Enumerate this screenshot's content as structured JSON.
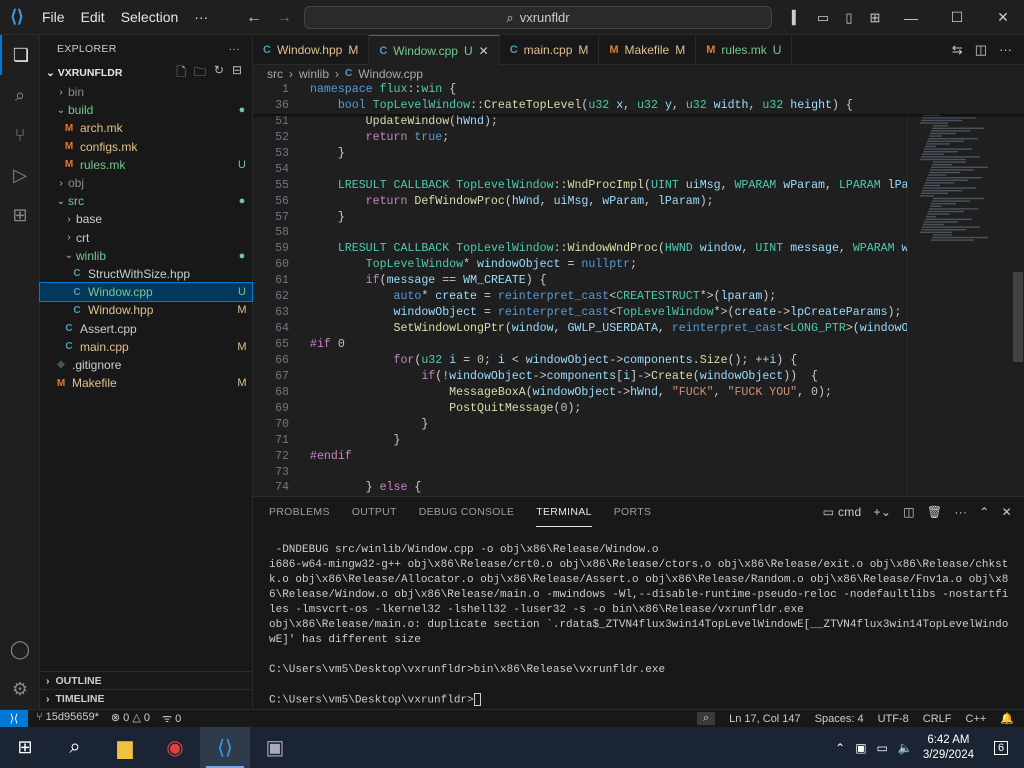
{
  "menu": {
    "file": "File",
    "edit": "Edit",
    "selection": "Selection",
    "more": "···"
  },
  "search": {
    "text": "vxrunfldr"
  },
  "explorer": {
    "title": "EXPLORER",
    "root": "VXRUNFLDR",
    "items": [
      {
        "name": "bin",
        "chev": "›",
        "indent": 0,
        "type": "folder",
        "badge": "",
        "color": "dim"
      },
      {
        "name": "build",
        "chev": "⌄",
        "indent": 0,
        "type": "folder",
        "badge": "●",
        "color": "unt"
      },
      {
        "name": "arch.mk",
        "indent": 1,
        "type": "M",
        "badge": "",
        "color": "mod"
      },
      {
        "name": "configs.mk",
        "indent": 1,
        "type": "M",
        "badge": "",
        "color": "mod"
      },
      {
        "name": "rules.mk",
        "indent": 1,
        "type": "M",
        "badge": "U",
        "color": "unt"
      },
      {
        "name": "obj",
        "chev": "›",
        "indent": 0,
        "type": "folder",
        "badge": "",
        "color": "dim"
      },
      {
        "name": "src",
        "chev": "⌄",
        "indent": 0,
        "type": "folder",
        "badge": "●",
        "color": "unt"
      },
      {
        "name": "base",
        "chev": "›",
        "indent": 1,
        "type": "folder",
        "badge": "",
        "color": ""
      },
      {
        "name": "crt",
        "chev": "›",
        "indent": 1,
        "type": "folder",
        "badge": "",
        "color": ""
      },
      {
        "name": "winlib",
        "chev": "⌄",
        "indent": 1,
        "type": "folder",
        "badge": "●",
        "color": "unt"
      },
      {
        "name": "StructWithSize.hpp",
        "indent": 2,
        "type": "C",
        "badge": "",
        "color": ""
      },
      {
        "name": "Window.cpp",
        "indent": 2,
        "type": "C",
        "badge": "U",
        "color": "unt",
        "selected": true
      },
      {
        "name": "Window.hpp",
        "indent": 2,
        "type": "C",
        "badge": "M",
        "color": "mod"
      },
      {
        "name": "Assert.cpp",
        "indent": 1,
        "type": "C",
        "badge": "",
        "color": ""
      },
      {
        "name": "main.cpp",
        "indent": 1,
        "type": "C",
        "badge": "M",
        "color": "mod"
      },
      {
        "name": ".gitignore",
        "indent": 0,
        "type": "G",
        "badge": "",
        "color": ""
      },
      {
        "name": "Makefile",
        "indent": 0,
        "type": "M",
        "badge": "M",
        "color": "mod"
      }
    ],
    "outline": "OUTLINE",
    "timeline": "TIMELINE"
  },
  "tabs": [
    {
      "name": "Window.hpp",
      "badge": "M",
      "icon": "C",
      "active": false,
      "color": "mod"
    },
    {
      "name": "Window.cpp",
      "badge": "U",
      "icon": "C",
      "active": true,
      "color": "unt"
    },
    {
      "name": "main.cpp",
      "badge": "M",
      "icon": "C",
      "active": false,
      "color": "mod"
    },
    {
      "name": "Makefile",
      "badge": "M",
      "icon": "M",
      "active": false,
      "color": "mod"
    },
    {
      "name": "rules.mk",
      "badge": "U",
      "icon": "M",
      "active": false,
      "color": "unt"
    }
  ],
  "breadcrumb": [
    "src",
    "winlib",
    "Window.cpp"
  ],
  "sticky_lines": [
    {
      "n": "1",
      "html": "<span class='kw'>namespace</span> <span class='ty'>flux</span>::<span class='ty'>win</span> {"
    },
    {
      "n": "36",
      "html": "    <span class='kw'>bool</span> <span class='ty'>TopLevelWindow</span>::<span class='fn'>CreateTopLevel</span>(<span class='ty'>u32</span> <span class='vr'>x</span>, <span class='ty'>u32</span> <span class='vr'>y</span>, <span class='ty'>u32</span> <span class='vr'>width</span>, <span class='ty'>u32</span> <span class='vr'>height</span>) {"
    }
  ],
  "code_lines": [
    {
      "n": "51",
      "html": "        <span class='fn'>UpdateWindow</span>(<span class='vr'>hWnd</span>);"
    },
    {
      "n": "52",
      "html": "        <span class='ctl'>return</span> <span class='kw'>true</span>;"
    },
    {
      "n": "53",
      "html": "    }"
    },
    {
      "n": "54",
      "html": ""
    },
    {
      "n": "55",
      "html": "    <span class='ty'>LRESULT</span> <span class='ty'>CALLBACK</span> <span class='ty'>TopLevelWindow</span>::<span class='fn'>WndProcImpl</span>(<span class='ty'>UINT</span> <span class='vr'>uiMsg</span>, <span class='ty'>WPARAM</span> <span class='vr'>wParam</span>, <span class='ty'>LPARAM</span> <span class='vr'>lParam</span>) {"
    },
    {
      "n": "56",
      "html": "        <span class='ctl'>return</span> <span class='fn'>DefWindowProc</span>(<span class='vr'>hWnd</span>, <span class='vr'>uiMsg</span>, <span class='vr'>wParam</span>, <span class='vr'>lParam</span>);"
    },
    {
      "n": "57",
      "html": "    }"
    },
    {
      "n": "58",
      "html": ""
    },
    {
      "n": "59",
      "html": "    <span class='ty'>LRESULT</span> <span class='ty'>CALLBACK</span> <span class='ty'>TopLevelWindow</span>::<span class='fn'>WindowWndProc</span>(<span class='ty'>HWND</span> <span class='vr'>window</span>, <span class='ty'>UINT</span> <span class='vr'>message</span>, <span class='ty'>WPARAM</span> <span class='vr'>wparam</span>, <span class='ty'>L</span>"
    },
    {
      "n": "60",
      "html": "        <span class='ty'>TopLevelWindow</span>* <span class='vr'>windowObject</span> = <span class='kw'>nullptr</span>;"
    },
    {
      "n": "61",
      "html": "        <span class='ctl'>if</span>(<span class='vr'>message</span> == <span class='vr'>WM_CREATE</span>) {"
    },
    {
      "n": "62",
      "html": "            <span class='kw'>auto</span>* <span class='vr'>create</span> = <span class='kw'>reinterpret_cast</span>&lt;<span class='ty'>CREATESTRUCT</span>*&gt;(<span class='vr'>lparam</span>);"
    },
    {
      "n": "63",
      "html": "            <span class='vr'>windowObject</span> = <span class='kw'>reinterpret_cast</span>&lt;<span class='ty'>TopLevelWindow</span>*&gt;(<span class='vr'>create</span>-&gt;<span class='vr'>lpCreateParams</span>);"
    },
    {
      "n": "64",
      "html": "            <span class='fn'>SetWindowLongPtr</span>(<span class='vr'>window</span>, <span class='vr'>GWLP_USERDATA</span>, <span class='kw'>reinterpret_cast</span>&lt;<span class='ty'>LONG_PTR</span>&gt;(<span class='vr'>windowObject</span>));"
    },
    {
      "n": "65",
      "html": "<span class='pp'>#if</span> <span class='num'>0</span>"
    },
    {
      "n": "66",
      "html": "            <span class='ctl'>for</span>(<span class='ty'>u32</span> <span class='vr'>i</span> = <span class='num'>0</span>; <span class='vr'>i</span> &lt; <span class='vr'>windowObject</span>-&gt;<span class='vr'>components</span>.<span class='fn'>Size</span>(); ++<span class='vr'>i</span>) {"
    },
    {
      "n": "67",
      "html": "                <span class='ctl'>if</span>(!<span class='vr'>windowObject</span>-&gt;<span class='vr'>components</span>[<span class='vr'>i</span>]-&gt;<span class='fn'>Create</span>(<span class='vr'>windowObject</span>))  {"
    },
    {
      "n": "68",
      "html": "                    <span class='fn'>MessageBoxA</span>(<span class='vr'>windowObject</span>-&gt;<span class='vr'>hWnd</span>, <span class='str'>\"FUCK\"</span>, <span class='str'>\"FUCK YOU\"</span>, <span class='num'>0</span>);"
    },
    {
      "n": "69",
      "html": "                    <span class='fn'>PostQuitMessage</span>(<span class='num'>0</span>);"
    },
    {
      "n": "70",
      "html": "                }"
    },
    {
      "n": "71",
      "html": "            }"
    },
    {
      "n": "72",
      "html": "<span class='pp'>#endif</span>"
    },
    {
      "n": "73",
      "html": ""
    },
    {
      "n": "74",
      "html": "        } <span class='ctl'>else</span> {"
    }
  ],
  "panel": {
    "tabs": [
      "PROBLEMS",
      "OUTPUT",
      "DEBUG CONSOLE",
      "TERMINAL",
      "PORTS"
    ],
    "active": "TERMINAL",
    "shell": "cmd",
    "terminal": " -DNDEBUG src/winlib/Window.cpp -o obj\\x86\\Release/Window.o\ni686-w64-mingw32-g++ obj\\x86\\Release/crt0.o obj\\x86\\Release/ctors.o obj\\x86\\Release/exit.o obj\\x86\\Release/chkstk.o obj\\x86\\Release/Allocator.o obj\\x86\\Release/Assert.o obj\\x86\\Release/Random.o obj\\x86\\Release/Fnv1a.o obj\\x86\\Release/Window.o obj\\x86\\Release/main.o -mwindows -Wl,--disable-runtime-pseudo-reloc -nodefaultlibs -nostartfiles -lmsvcrt-os -lkernel32 -lshell32 -luser32 -s -o bin\\x86\\Release/vxrunfldr.exe\nobj\\x86\\Release/main.o: duplicate section `.rdata$_ZTVN4flux3win14TopLevelWindowE[__ZTVN4flux3win14TopLevelWindowE]' has different size\n\nC:\\Users\\vm5\\Desktop\\vxrunfldr>bin\\x86\\Release\\vxrunfldr.exe\n\nC:\\Users\\vm5\\Desktop\\vxrunfldr>"
  },
  "status": {
    "branch": "15d95659*",
    "errors": "0",
    "warnings": "0",
    "info": "0",
    "position": "Ln 17, Col 147",
    "spaces": "Spaces: 4",
    "encoding": "UTF-8",
    "eol": "CRLF",
    "language": "C++"
  },
  "taskbar": {
    "time": "6:42 AM",
    "date": "3/29/2024",
    "notifications": "6"
  },
  "colors": {
    "accent": "#0078d4",
    "modified": "#e2c08d",
    "untracked": "#73c991"
  }
}
